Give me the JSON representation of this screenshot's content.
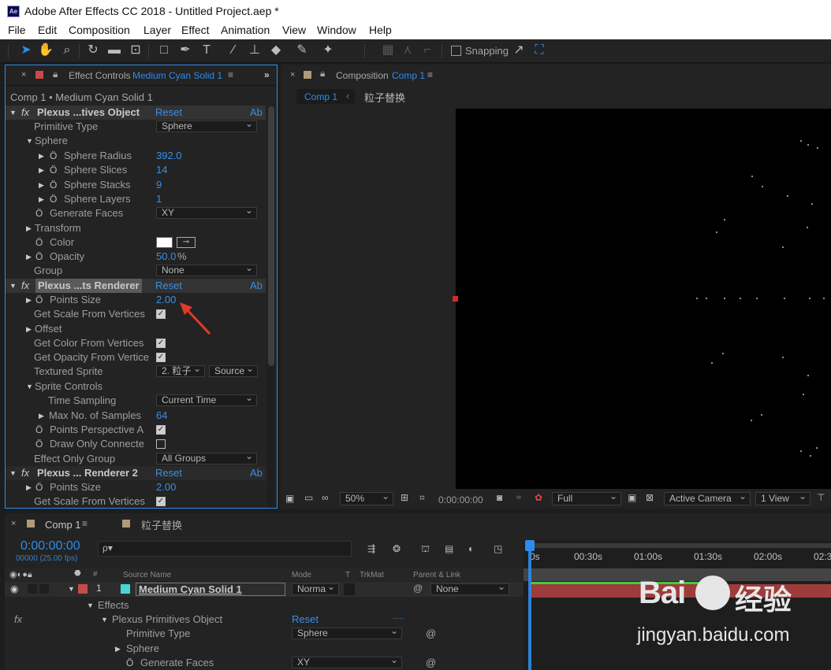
{
  "app": {
    "title": "Adobe After Effects CC 2018 - Untitled Project.aep *",
    "logo": "Ae"
  },
  "menu": [
    "File",
    "Edit",
    "Composition",
    "Layer",
    "Effect",
    "Animation",
    "View",
    "Window",
    "Help"
  ],
  "toolbar": {
    "snapping_label": "Snapping"
  },
  "effect_controls": {
    "tab_prefix": "Effect Controls",
    "tab_layer": "Medium Cyan Solid 1",
    "breadcrumb": "Comp 1 • Medium Cyan Solid 1",
    "reset_label": "Reset",
    "ab_label": "Ab",
    "fx1": {
      "name": "Plexus ...tives Object",
      "primitive_type_label": "Primitive Type",
      "primitive_type_value": "Sphere",
      "sphere_label": "Sphere",
      "sphere_radius_label": "Sphere Radius",
      "sphere_radius_value": "392.0",
      "sphere_slices_label": "Sphere Slices",
      "sphere_slices_value": "14",
      "sphere_stacks_label": "Sphere Stacks",
      "sphere_stacks_value": "9",
      "sphere_layers_label": "Sphere Layers",
      "sphere_layers_value": "1",
      "generate_faces_label": "Generate Faces",
      "generate_faces_value": "XY",
      "transform_label": "Transform",
      "color_label": "Color",
      "opacity_label": "Opacity",
      "opacity_value": "50.0",
      "opacity_unit": "%",
      "group_label": "Group",
      "group_value": "None"
    },
    "fx2": {
      "name": "Plexus ...ts Renderer",
      "points_size_label": "Points Size",
      "points_size_value": "2.00",
      "scale_label": "Get Scale From Vertices",
      "offset_label": "Offset",
      "color_vert_label": "Get Color From Vertices",
      "opacity_vert_label": "Get Opacity From Vertice",
      "textured_label": "Textured Sprite",
      "textured_value": "2. 粒子",
      "source_value": "Source",
      "sprite_controls_label": "Sprite Controls",
      "time_sampling_label": "Time Sampling",
      "time_sampling_value": "Current Time",
      "max_samples_label": "Max No. of Samples",
      "max_samples_value": "64",
      "points_persp_label": "Points Perspective A",
      "draw_only_label": "Draw Only Connecte",
      "effect_only_label": "Effect Only Group",
      "effect_only_value": "All Groups"
    },
    "fx3": {
      "name": "Plexus ... Renderer 2",
      "points_size_label": "Points Size",
      "points_size_value": "2.00",
      "scale_label": "Get Scale From Vertices"
    }
  },
  "composition": {
    "tab_prefix": "Composition",
    "tab_comp": "Comp 1",
    "crumb_comp": "Comp 1",
    "crumb_next": "粒子替换",
    "bottom": {
      "zoom": "50%",
      "timecode": "0:00:00:00",
      "resolution": "Full",
      "camera": "Active Camera",
      "views": "1 View"
    }
  },
  "timeline": {
    "tab1": "Comp 1",
    "tab2": "粒子替换",
    "timecode": "0:00:00:00",
    "fps": "00000 (25.00 fps)",
    "search_placeholder": "ρ▾",
    "headers": {
      "source_name": "Source Name",
      "mode": "Mode",
      "t": "T",
      "trkmat": "TrkMat",
      "parent": "Parent & Link"
    },
    "ruler": [
      "0s",
      "00:30s",
      "01:00s",
      "01:30s",
      "02:00s",
      "02:3"
    ],
    "layer": {
      "num": "1",
      "name": "Medium Cyan Solid 1",
      "mode": "Norma",
      "parent": "None"
    },
    "effects_label": "Effects",
    "ppo_label": "Plexus Primitives Object",
    "reset_label": "Reset",
    "ellipsis": ".....",
    "primitive_type_label": "Primitive Type",
    "primitive_type_value": "Sphere",
    "sphere_label": "Sphere",
    "generate_faces_label": "Generate Faces",
    "generate_faces_value": "XY"
  },
  "watermark": {
    "text1": "Bai",
    "text2": "经验",
    "url": "jingyan.baidu.com"
  },
  "colors": {
    "accent": "#2d8ceb",
    "layer_label": "#c94a4a",
    "solid_swatch": "#45d6d6",
    "layer_bar": "#9e3b3b"
  }
}
